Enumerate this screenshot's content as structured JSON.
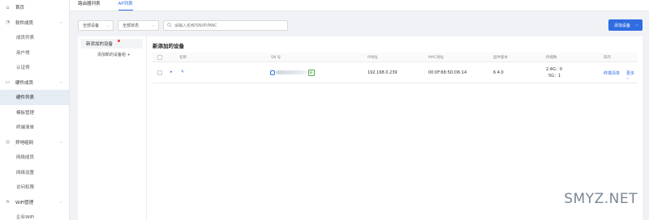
{
  "sidebar": {
    "items": [
      {
        "label": "首页",
        "type": "top",
        "icon": "home-icon",
        "glyph": "⌂"
      },
      {
        "label": "软件成员",
        "type": "top",
        "icon": "software-members-icon",
        "glyph": "◔",
        "expanded": true
      },
      {
        "label": "成员列表",
        "type": "sub"
      },
      {
        "label": "用户得",
        "type": "sub"
      },
      {
        "label": "认证得",
        "type": "sub"
      },
      {
        "label": "硬件成员",
        "type": "top",
        "icon": "hardware-members-icon",
        "glyph": "▭",
        "expanded": true
      },
      {
        "label": "硬件列表",
        "type": "sub",
        "active": true
      },
      {
        "label": "模板管理",
        "type": "sub"
      },
      {
        "label": "终端清单",
        "type": "sub"
      },
      {
        "label": "异地组网",
        "type": "top",
        "icon": "remote-network-icon",
        "glyph": "◎",
        "expanded": true
      },
      {
        "label": "网络成员",
        "type": "sub"
      },
      {
        "label": "网络设置",
        "type": "sub"
      },
      {
        "label": "访问权限",
        "type": "sub"
      },
      {
        "label": "WiFi管理",
        "type": "top",
        "icon": "wifi-icon",
        "glyph": "≋",
        "expanded": true
      },
      {
        "label": "企业WiFi",
        "type": "sub"
      }
    ]
  },
  "tabs": [
    "路由器列表",
    "AP列表"
  ],
  "filters": {
    "device_select": "全部设备",
    "status_select": "全部状态",
    "search_placeholder": "请输入名称/SN/IP/MAC",
    "add_button": "添加设备"
  },
  "left_panel": {
    "active_item": "新添加的设备",
    "add_group": "添加新的设备组 +"
  },
  "table": {
    "title": "新添加的设备",
    "headers": [
      "名称",
      "SN 号",
      "IP地址",
      "MAC地址",
      "固件版本",
      "终端数",
      "操作"
    ],
    "row": {
      "sn_tag": "新",
      "ip": "192.168.0.239",
      "mac": "00:0F:68:5D:D6:14",
      "firmware": "6.4.0",
      "terminals_24": "2.4G：0",
      "terminals_5": "5G：1",
      "action_link": "终端清单",
      "more": "更多"
    }
  },
  "watermark": "SMYZ.NET",
  "colors": {
    "accent": "#2f6de1",
    "tag_green": "#4caf50",
    "badge_red": "#e8393e"
  }
}
